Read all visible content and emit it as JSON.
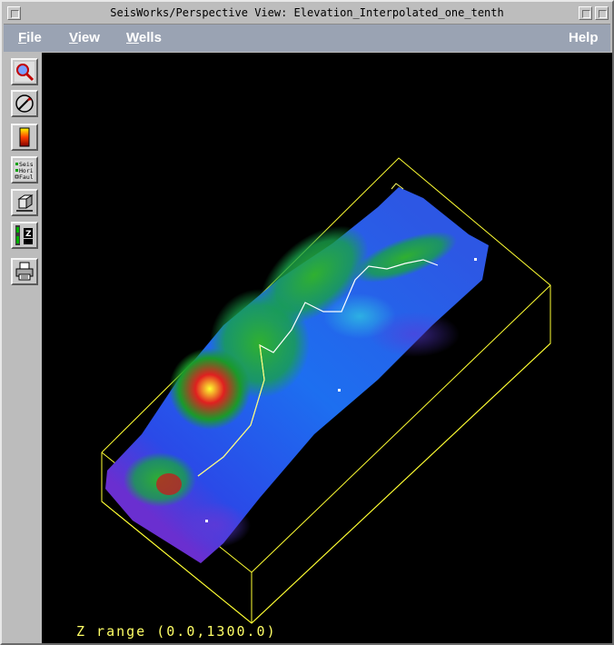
{
  "window": {
    "title": "SeisWorks/Perspective View: Elevation_Interpolated_one_tenth"
  },
  "menu": {
    "file": {
      "accel": "F",
      "rest": "ile"
    },
    "view": {
      "accel": "V",
      "rest": "iew"
    },
    "wells": {
      "accel": "W",
      "rest": "ells"
    },
    "help": "Help"
  },
  "toolbar": {
    "layers_icon_lines": [
      "Seis",
      "Hori",
      "Faul"
    ]
  },
  "viewport": {
    "z_range": "Z range (0.0,1300.0)",
    "colors": {
      "background": "#000000",
      "bounding_box": "#ffff33",
      "well_path": "#ffffff"
    }
  }
}
